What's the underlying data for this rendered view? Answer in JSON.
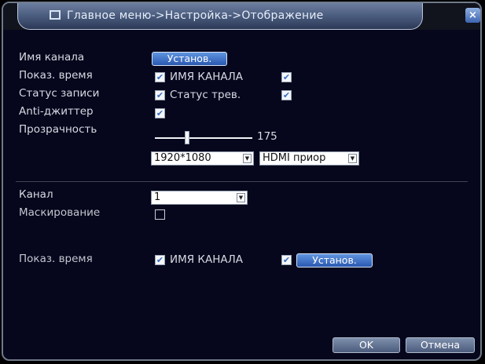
{
  "window": {
    "title": "Главное меню->Настройка->Отображение",
    "close_glyph": "×"
  },
  "labels": {
    "channel_name": "Имя канала",
    "show_time": "Показ. время",
    "record_status": "Статус записи",
    "anti_jitter": "Anti-джиттер",
    "transparency": "Прозрачность",
    "channel": "Канал",
    "masking": "Маскирование",
    "show_time_2": "Показ. время"
  },
  "controls": {
    "setup_button": "Установ.",
    "setup_button_2": "Установ.",
    "channel_name_checkbox_label": "ИМЯ КАНАЛА",
    "alarm_status_checkbox_label": "Статус трев.",
    "channel_name_checkbox_label_2": "ИМЯ КАНАЛА",
    "transparency_value": "175",
    "resolution_select": "1920*1080",
    "output_select": "HDMI приор",
    "channel_select": "1",
    "ok_button": "OK",
    "cancel_button": "Отмена"
  },
  "state": {
    "show_time_checked": true,
    "channel_name_checked": true,
    "record_status_checked": true,
    "alarm_status_checked": true,
    "anti_jitter_checked": true,
    "masking_checked": false,
    "show_time_2_checked": true,
    "channel_name_2_checked": true,
    "transparency_fraction": 0.33
  },
  "icons": {
    "menu_icon": "window-icon",
    "checkmark": "✔",
    "dropdown": "▼"
  },
  "colors": {
    "background": "#06061c",
    "accent_button": "#2a58b0",
    "title_gradient": "#47587a",
    "text": "#d6dbe3"
  }
}
